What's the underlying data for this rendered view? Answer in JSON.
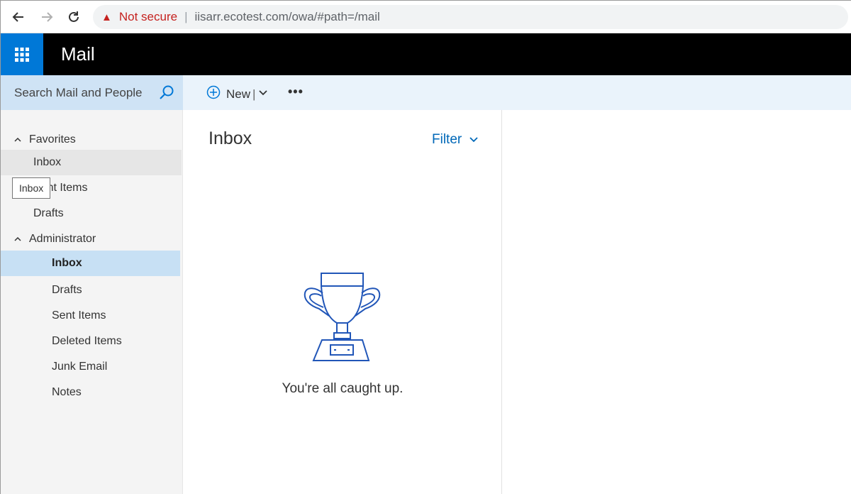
{
  "browser": {
    "security_label": "Not secure",
    "url": "iisarr.ecotest.com/owa/#path=/mail"
  },
  "header": {
    "app_title": "Mail"
  },
  "search": {
    "placeholder": "Search Mail and People"
  },
  "commandbar": {
    "new_label": "New",
    "more_label": "•••"
  },
  "sidebar": {
    "favorites": {
      "label": "Favorites",
      "items": [
        {
          "label": "Inbox"
        },
        {
          "label": "Sent Items"
        },
        {
          "label": "Drafts"
        }
      ]
    },
    "account": {
      "label": "Administrator",
      "items": [
        {
          "label": "Inbox"
        },
        {
          "label": "Drafts"
        },
        {
          "label": "Sent Items"
        },
        {
          "label": "Deleted Items"
        },
        {
          "label": "Junk Email"
        },
        {
          "label": "Notes"
        }
      ]
    },
    "tooltip": "Inbox"
  },
  "message_list": {
    "title": "Inbox",
    "filter_label": "Filter",
    "empty_message": "You're all caught up."
  },
  "colors": {
    "accent": "#0078d7",
    "selected_row": "#c7e0f4",
    "link": "#0068b8",
    "warning": "#c5221f"
  },
  "icons": {
    "back": "back-arrow-icon",
    "forward": "forward-arrow-icon",
    "reload": "reload-icon",
    "warning": "warning-icon",
    "waffle": "app-launcher-icon",
    "search": "search-icon",
    "add": "plus-circle-icon",
    "trophy": "trophy-icon"
  }
}
